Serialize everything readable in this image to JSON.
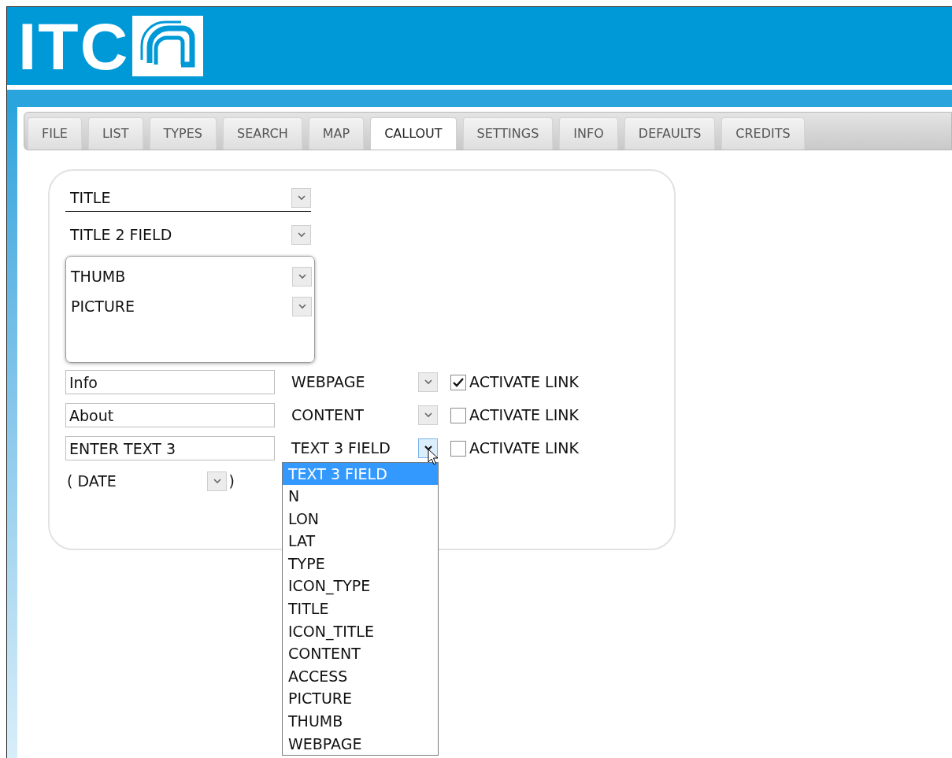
{
  "logo": {
    "text": "ITC"
  },
  "tabs": [
    {
      "label": "FILE",
      "selected": false
    },
    {
      "label": "LIST",
      "selected": false
    },
    {
      "label": "TYPES",
      "selected": false
    },
    {
      "label": "SEARCH",
      "selected": false
    },
    {
      "label": "MAP",
      "selected": false
    },
    {
      "label": "CALLOUT",
      "selected": true
    },
    {
      "label": "SETTINGS",
      "selected": false
    },
    {
      "label": "INFO",
      "selected": false
    },
    {
      "label": "DEFAULTS",
      "selected": false
    },
    {
      "label": "CREDITS",
      "selected": false
    }
  ],
  "title_selects": [
    {
      "value": "TITLE"
    },
    {
      "value": "TITLE 2 FIELD"
    }
  ],
  "image_selects": [
    {
      "value": "THUMB"
    },
    {
      "value": "PICTURE"
    }
  ],
  "links": [
    {
      "text": "Info",
      "field": "WEBPAGE",
      "open": false,
      "checked": true,
      "checkbox_label": "ACTIVATE LINK"
    },
    {
      "text": "About",
      "field": "CONTENT",
      "open": false,
      "checked": false,
      "checkbox_label": "ACTIVATE LINK"
    },
    {
      "text": "ENTER TEXT 3",
      "field": "TEXT 3 FIELD",
      "open": true,
      "checked": false,
      "checkbox_label": "ACTIVATE LINK"
    }
  ],
  "date": {
    "open_paren": "(",
    "value": "DATE",
    "close_paren": ")"
  },
  "dropdown_options": [
    {
      "label": "TEXT 3 FIELD",
      "selected": true
    },
    {
      "label": "N",
      "selected": false
    },
    {
      "label": "LON",
      "selected": false
    },
    {
      "label": "LAT",
      "selected": false
    },
    {
      "label": "TYPE",
      "selected": false
    },
    {
      "label": "ICON_TYPE",
      "selected": false
    },
    {
      "label": "TITLE",
      "selected": false
    },
    {
      "label": "ICON_TITLE",
      "selected": false
    },
    {
      "label": "CONTENT",
      "selected": false
    },
    {
      "label": "ACCESS",
      "selected": false
    },
    {
      "label": "PICTURE",
      "selected": false
    },
    {
      "label": "THUMB",
      "selected": false
    },
    {
      "label": "WEBPAGE",
      "selected": false
    }
  ]
}
